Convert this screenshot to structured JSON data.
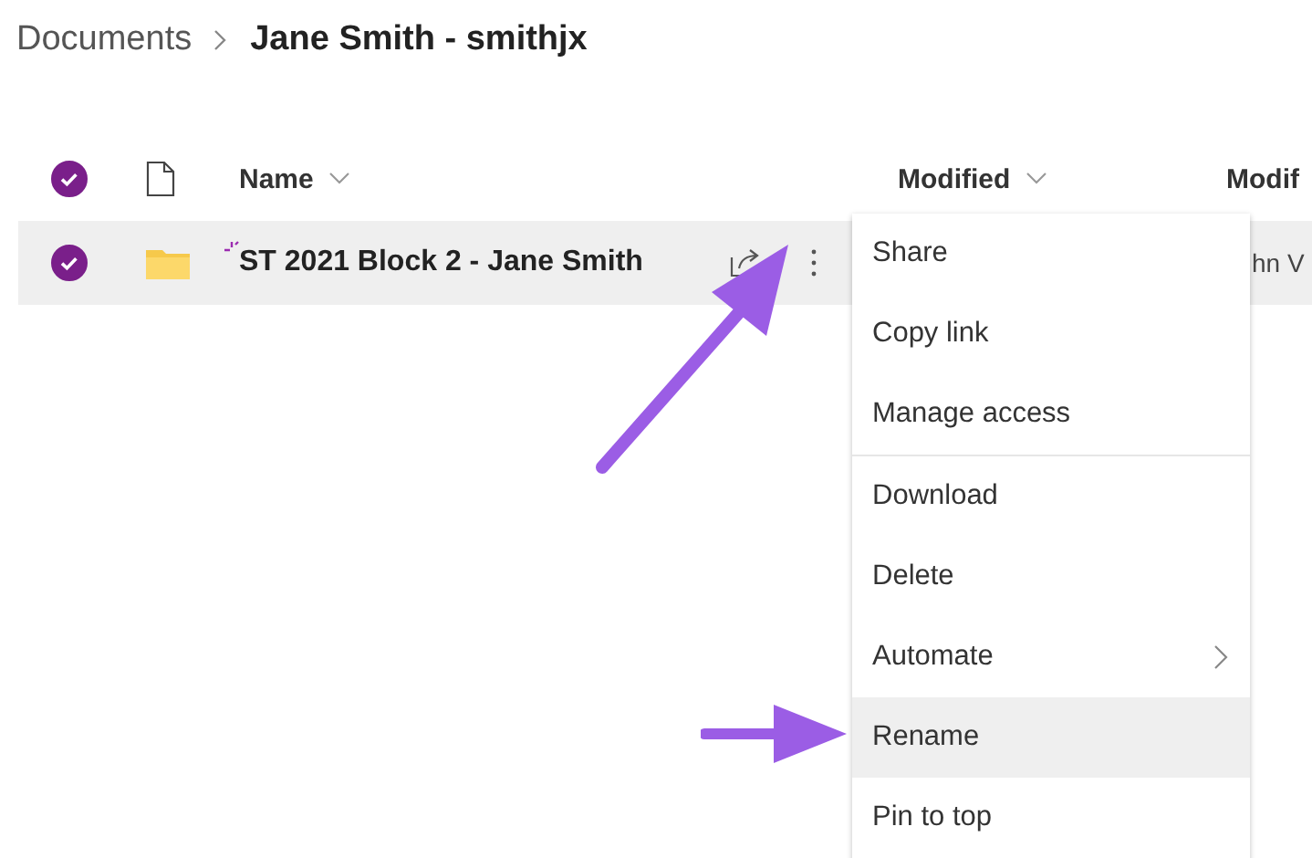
{
  "breadcrumb": [
    {
      "label": "Documents",
      "current": false
    },
    {
      "label": "Jane Smith - smithjx",
      "current": true
    }
  ],
  "columns": [
    {
      "label": "Name",
      "sortable": true
    },
    {
      "label": "Modified",
      "sortable": true
    },
    {
      "label": "Modif",
      "sortable": false
    }
  ],
  "header_checked": true,
  "rows": [
    {
      "name": "ST 2021 Block 2 - Jane Smith",
      "new": true,
      "checked": true,
      "column_3": "hn V"
    }
  ],
  "menu": {
    "groups": [
      [
        {
          "label": "Share",
          "selected": false,
          "submenu": false
        },
        {
          "label": "Copy link",
          "selected": false,
          "submenu": false
        },
        {
          "label": "Manage access",
          "selected": false,
          "submenu": false
        }
      ],
      [
        {
          "label": "Download",
          "selected": false,
          "submenu": false
        },
        {
          "label": "Delete",
          "selected": false,
          "submenu": false
        },
        {
          "label": "Automate",
          "selected": false,
          "submenu": true
        },
        {
          "label": "Rename",
          "selected": true,
          "submenu": false
        },
        {
          "label": "Pin to top",
          "selected": false,
          "submenu": false
        }
      ]
    ]
  }
}
